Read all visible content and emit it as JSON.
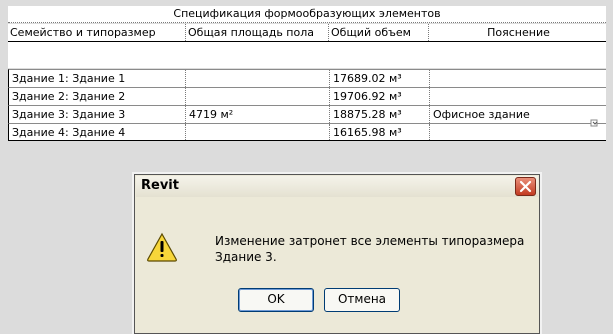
{
  "schedule": {
    "title": "Спецификация формообразующих элементов",
    "columns": [
      "Семейство и типоразмер",
      "Общая площадь пола",
      "Общий объем",
      "Пояснение"
    ],
    "rows": [
      {
        "family": "Здание 1: Здание 1",
        "area": "",
        "volume": "17689.02 м³",
        "note": ""
      },
      {
        "family": "Здание 2: Здание 2",
        "area": "",
        "volume": "19706.92 м³",
        "note": ""
      },
      {
        "family": "Здание 3: Здание 3",
        "area": "4719 м²",
        "volume": "18875.28 м³",
        "note": "Офисное здание"
      },
      {
        "family": "Здание 4: Здание 4",
        "area": "",
        "volume": "16165.98 м³",
        "note": ""
      }
    ]
  },
  "dialog": {
    "title": "Revit",
    "message_line1": "Изменение затронет все элементы типоразмера",
    "message_line2": "Здание 3.",
    "ok_label": "OK",
    "cancel_label": "Отмена",
    "icon": "warning-icon",
    "close_icon": "close-icon"
  },
  "colors": {
    "dialog_bg": "#ece9d8",
    "close_red": "#c23b22",
    "warning_yellow": "#f7d63a"
  }
}
